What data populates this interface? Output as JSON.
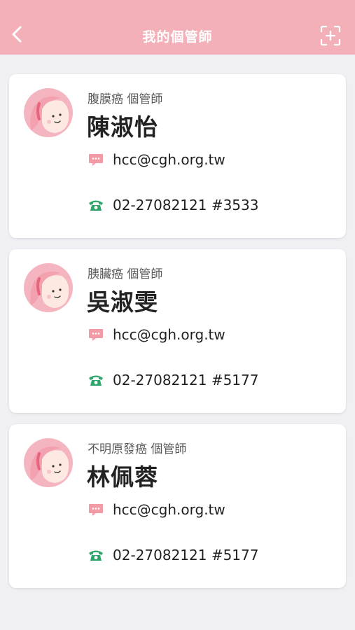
{
  "header": {
    "title": "我的個管師",
    "background": "#f3b0b8"
  },
  "case_managers": [
    {
      "department": "腹膜癌 個管師",
      "name": "陳淑怡",
      "email": "hcc@cgh.org.tw",
      "phone": "02-27082121 #3533"
    },
    {
      "department": "胰臟癌 個管師",
      "name": "吳淑雯",
      "email": "hcc@cgh.org.tw",
      "phone": "02-27082121 #5177"
    },
    {
      "department": "不明原發癌 個管師",
      "name": "林佩蓉",
      "email": "hcc@cgh.org.tw",
      "phone": "02-27082121 #5177"
    }
  ],
  "icons": {
    "back": "chevron-left-icon",
    "scan": "scan-add-icon",
    "email": "chat-bubble-icon",
    "phone": "telephone-icon",
    "avatar": "avatar-icon"
  },
  "colors": {
    "accent_pink": "#f3b0b8",
    "phone_green": "#2fa56b",
    "email_pink": "#f29aa6",
    "background": "#efeff4"
  }
}
